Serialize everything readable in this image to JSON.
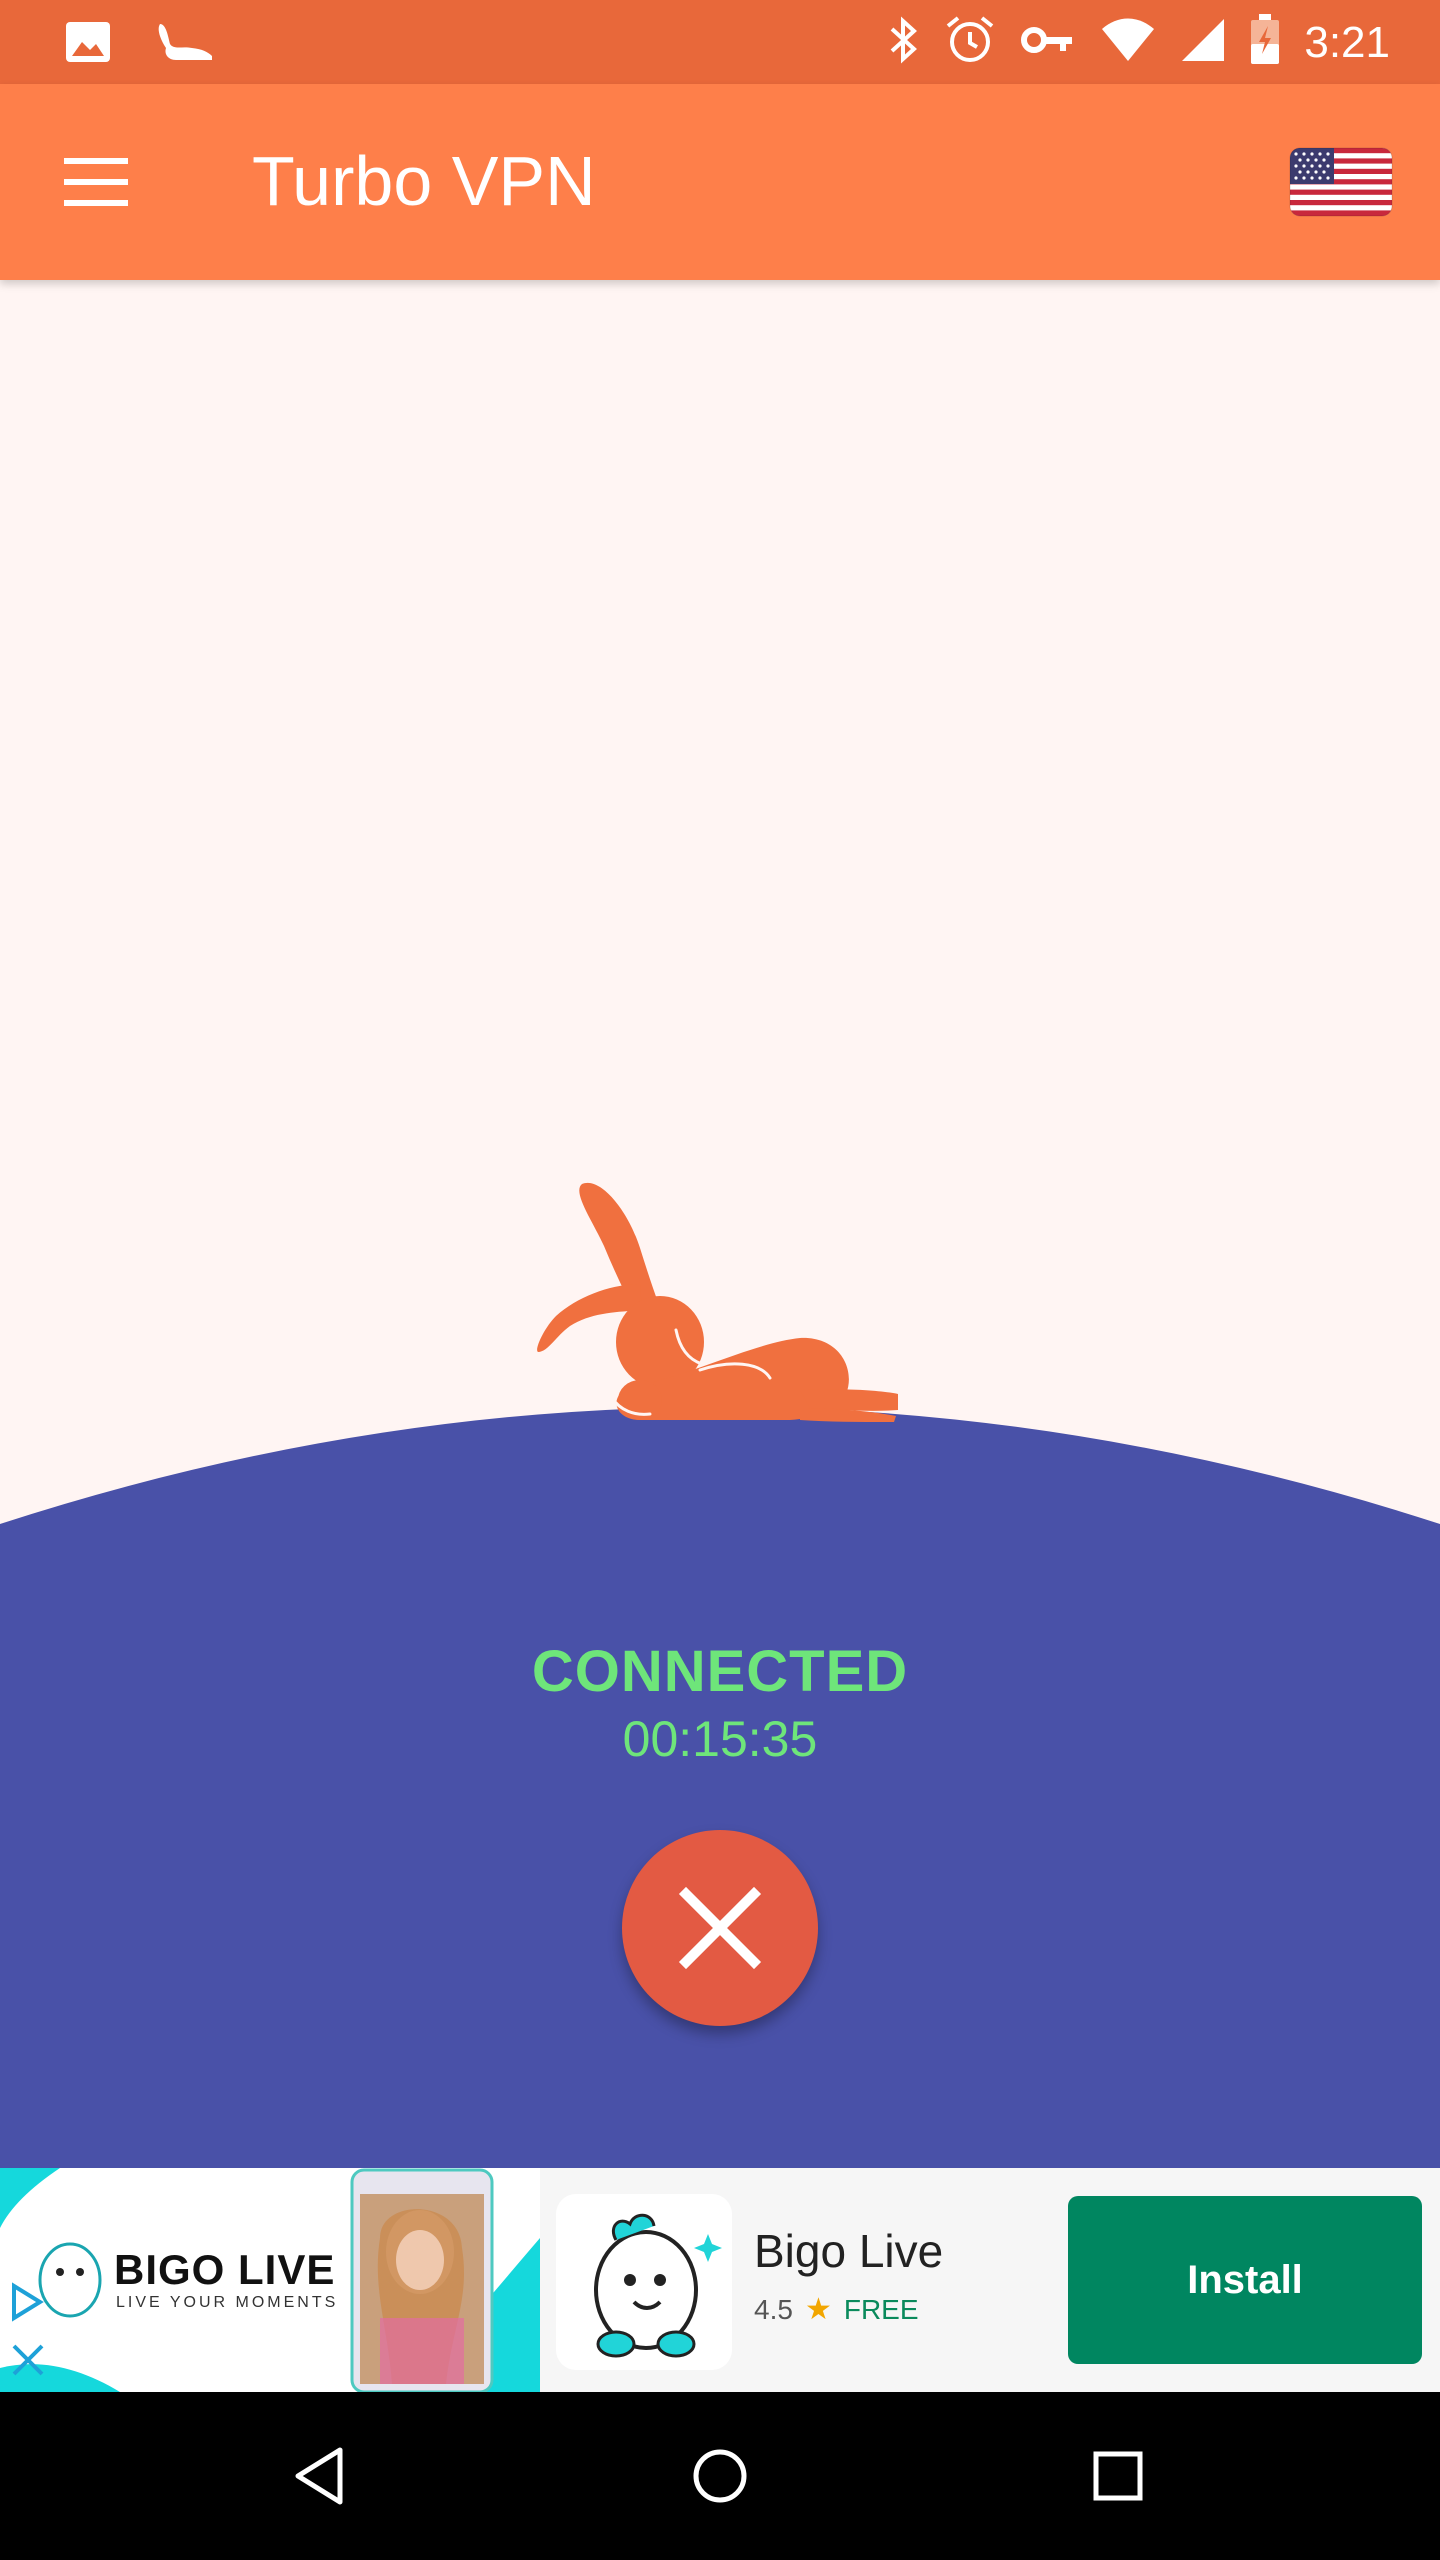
{
  "status_bar": {
    "time": "3:21",
    "left_icons": [
      "image-icon",
      "turbo-vpn-notification-icon"
    ],
    "right_icons": [
      "bluetooth-icon",
      "alarm-icon",
      "vpn-key-icon",
      "wifi-icon",
      "signal-icon",
      "battery-icon"
    ]
  },
  "app_bar": {
    "title": "Turbo VPN",
    "menu_icon": "menu-icon",
    "location_flag": "us-flag-icon"
  },
  "connection": {
    "status": "CONNECTED",
    "timer": "00:15:35",
    "disconnect_icon": "close-icon"
  },
  "ad": {
    "brand": "BIGO LIVE",
    "tagline": "LIVE YOUR MOMENTS",
    "app_name": "Bigo Live",
    "rating": "4.5",
    "price": "FREE",
    "install_label": "Install"
  },
  "nav_bar": {
    "icons": [
      "back-icon",
      "home-icon",
      "recents-icon"
    ]
  },
  "colors": {
    "status_bar": "#e8683a",
    "app_bar": "#fe7f4a",
    "background": "#fff5f3",
    "hill": "#4951a8",
    "connected_text": "#6ee57a",
    "disconnect_button": "#e35a43",
    "install_button": "#008660"
  }
}
